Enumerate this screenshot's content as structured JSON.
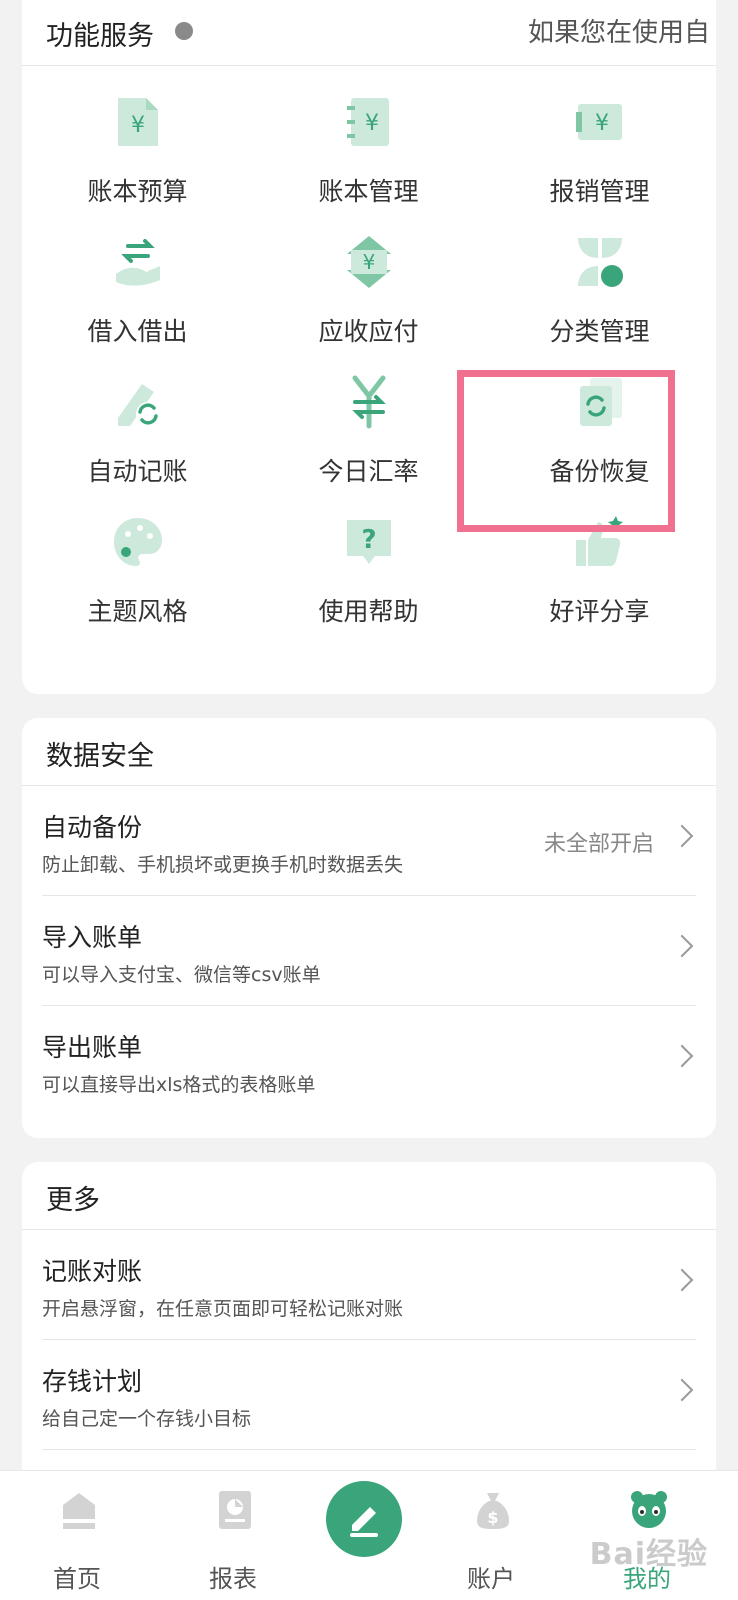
{
  "services": {
    "title": "功能服务",
    "marquee": "如果您在使用自",
    "items": [
      {
        "label": "账本预算",
        "icon": "budget-icon"
      },
      {
        "label": "账本管理",
        "icon": "ledger-icon"
      },
      {
        "label": "报销管理",
        "icon": "reimburse-icon"
      },
      {
        "label": "借入借出",
        "icon": "lend-borrow-icon"
      },
      {
        "label": "应收应付",
        "icon": "receivable-icon"
      },
      {
        "label": "分类管理",
        "icon": "category-icon"
      },
      {
        "label": "自动记账",
        "icon": "auto-record-icon"
      },
      {
        "label": "今日汇率",
        "icon": "exchange-rate-icon"
      },
      {
        "label": "备份恢复",
        "icon": "backup-restore-icon"
      },
      {
        "label": "主题风格",
        "icon": "palette-icon"
      },
      {
        "label": "使用帮助",
        "icon": "help-icon"
      },
      {
        "label": "好评分享",
        "icon": "thumbs-up-icon"
      }
    ],
    "highlighted": "备份恢复"
  },
  "data_security": {
    "title": "数据安全",
    "rows": [
      {
        "title": "自动备份",
        "subtitle": "防止卸载、手机损坏或更换手机时数据丢失",
        "value": "未全部开启"
      },
      {
        "title": "导入账单",
        "subtitle": "可以导入支付宝、微信等csv账单"
      },
      {
        "title": "导出账单",
        "subtitle": "可以直接导出xls格式的表格账单"
      }
    ]
  },
  "more": {
    "title": "更多",
    "rows": [
      {
        "title": "记账对账",
        "subtitle": "开启悬浮窗，在任意页面即可轻松记账对账"
      },
      {
        "title": "存钱计划",
        "subtitle": "给自己定一个存钱小目标"
      }
    ]
  },
  "tabbar": {
    "tabs": [
      {
        "label": "首页",
        "icon": "home-icon"
      },
      {
        "label": "报表",
        "icon": "report-icon"
      },
      {
        "label": "账户",
        "icon": "money-bag-icon"
      },
      {
        "label": "我的",
        "icon": "panda-icon"
      }
    ],
    "active": "我的",
    "watermark": "Bai经验"
  },
  "colors": {
    "accent": "#3aa57b",
    "icon_light": "#cde9dc",
    "icon_mid": "#7fc7a4",
    "highlight": "#f07090"
  }
}
